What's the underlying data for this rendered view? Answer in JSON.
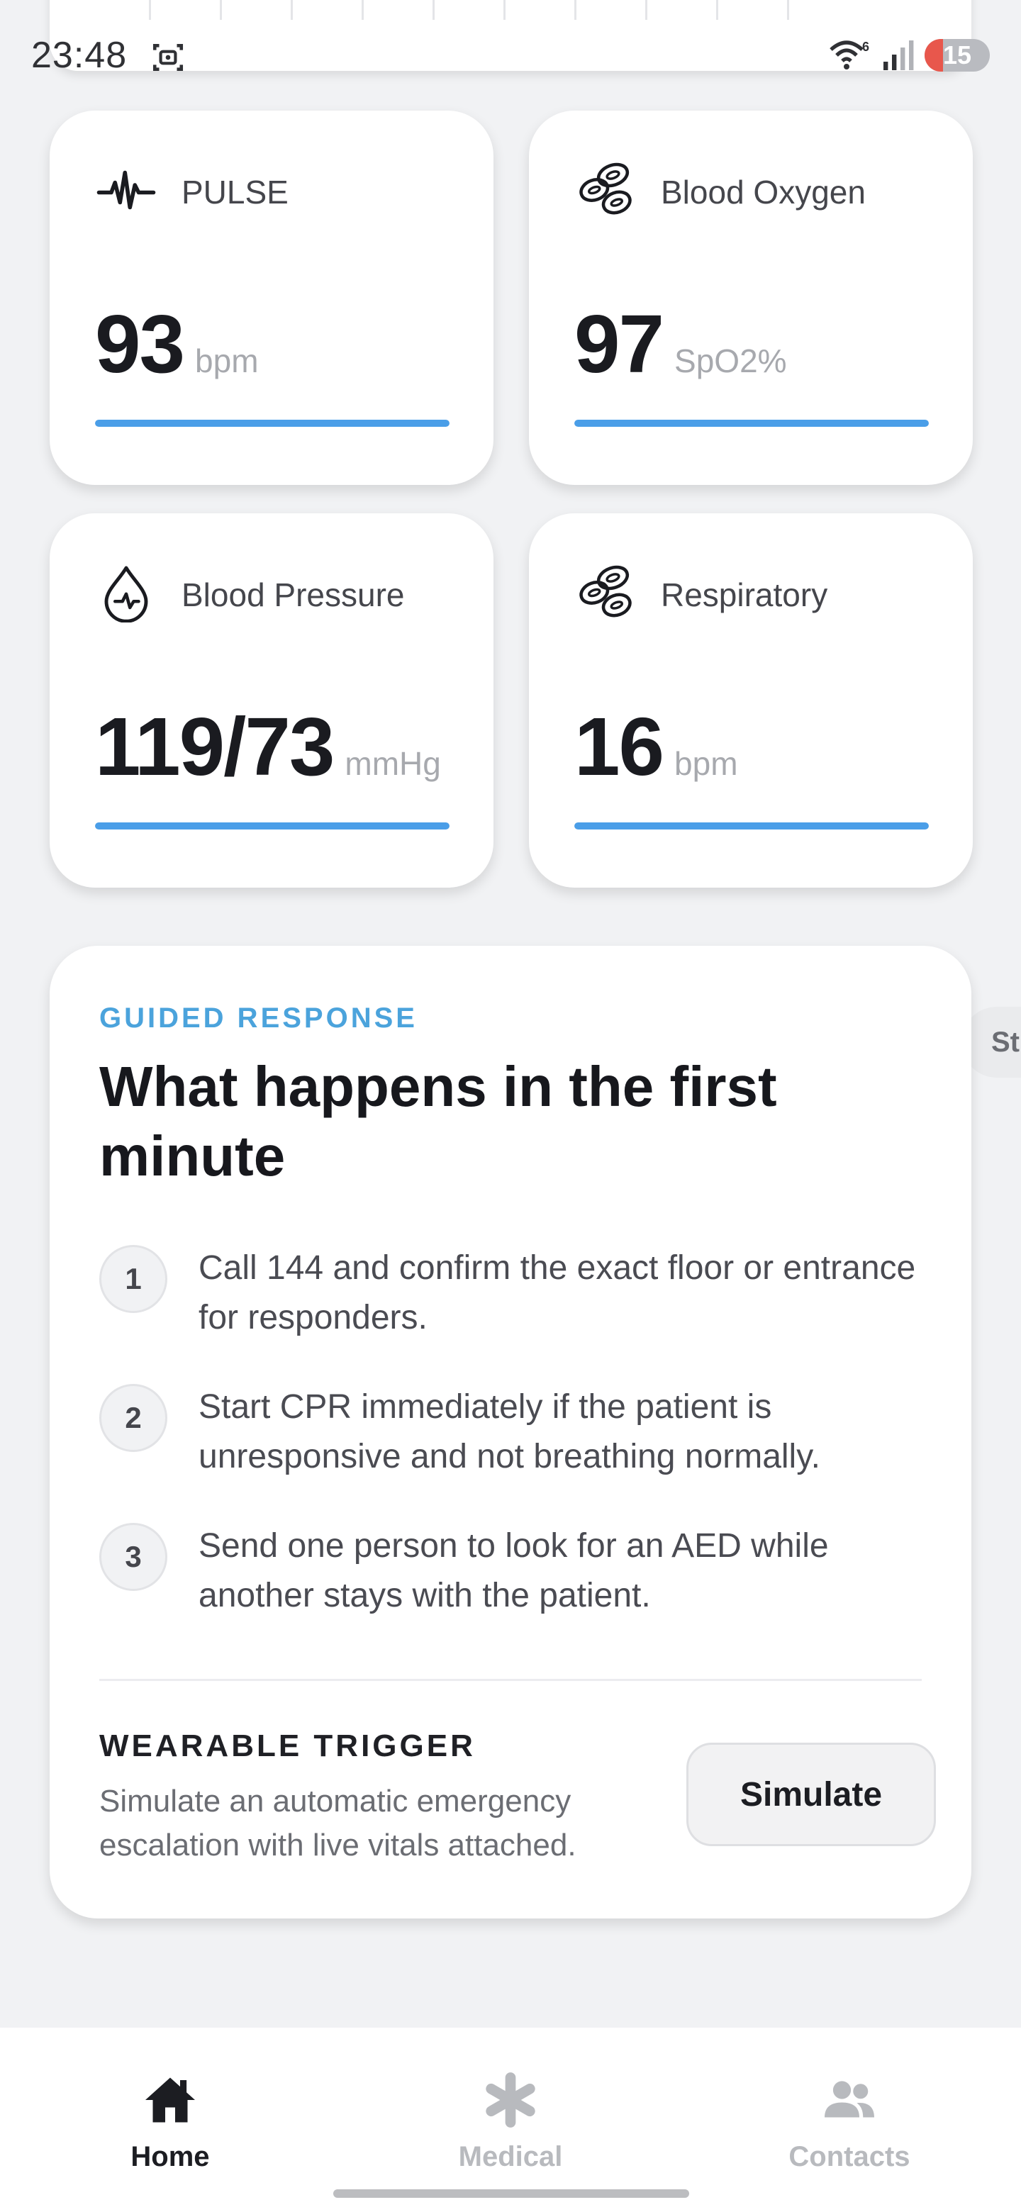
{
  "status_bar": {
    "time": "23:48",
    "battery": "15",
    "icons": [
      "screenshot-icon",
      "wifi-icon",
      "signal-icon",
      "battery-icon"
    ]
  },
  "vitals": [
    {
      "label": "PULSE",
      "value": "93",
      "unit": "bpm",
      "icon": "heartbeat-icon",
      "level": 1.0
    },
    {
      "label": "Blood Oxygen",
      "value": "97",
      "unit": "SpO2%",
      "icon": "blood-cells-icon",
      "level": 1.0
    },
    {
      "label": "Blood Pressure",
      "value": "119/73",
      "unit": "mmHg",
      "icon": "blood-drop-icon",
      "level": 1.0
    },
    {
      "label": "Respiratory",
      "value": "16",
      "unit": "bpm",
      "icon": "blood-cells-icon",
      "level": 1.0
    }
  ],
  "guided": {
    "eyebrow": "GUIDED RESPONSE",
    "title": "What happens in the first minute",
    "steps": [
      {
        "num": "1",
        "text": "Call 144 and confirm the exact floor or entrance for responders."
      },
      {
        "num": "2",
        "text": "Start CPR immediately if the patient is unresponsive and not breathing normally."
      },
      {
        "num": "3",
        "text": "Send one person to look for an AED while another stays with the patient."
      }
    ],
    "wearable_label": "WEARABLE TRIGGER",
    "wearable_desc": "Simulate an automatic emergency escalation with live vitals attached.",
    "simulate_label": "Simulate"
  },
  "side_pill": "St",
  "nav": {
    "items": [
      {
        "label": "Home",
        "icon": "home-icon",
        "active": true
      },
      {
        "label": "Medical",
        "icon": "asterisk-icon",
        "active": false
      },
      {
        "label": "Contacts",
        "icon": "contacts-icon",
        "active": false
      }
    ]
  },
  "colors": {
    "accent_blue": "#4a9ee8",
    "eyebrow_blue": "#4ba3dc",
    "nav_active": "#1c1d22",
    "nav_inactive": "#b8babe"
  }
}
